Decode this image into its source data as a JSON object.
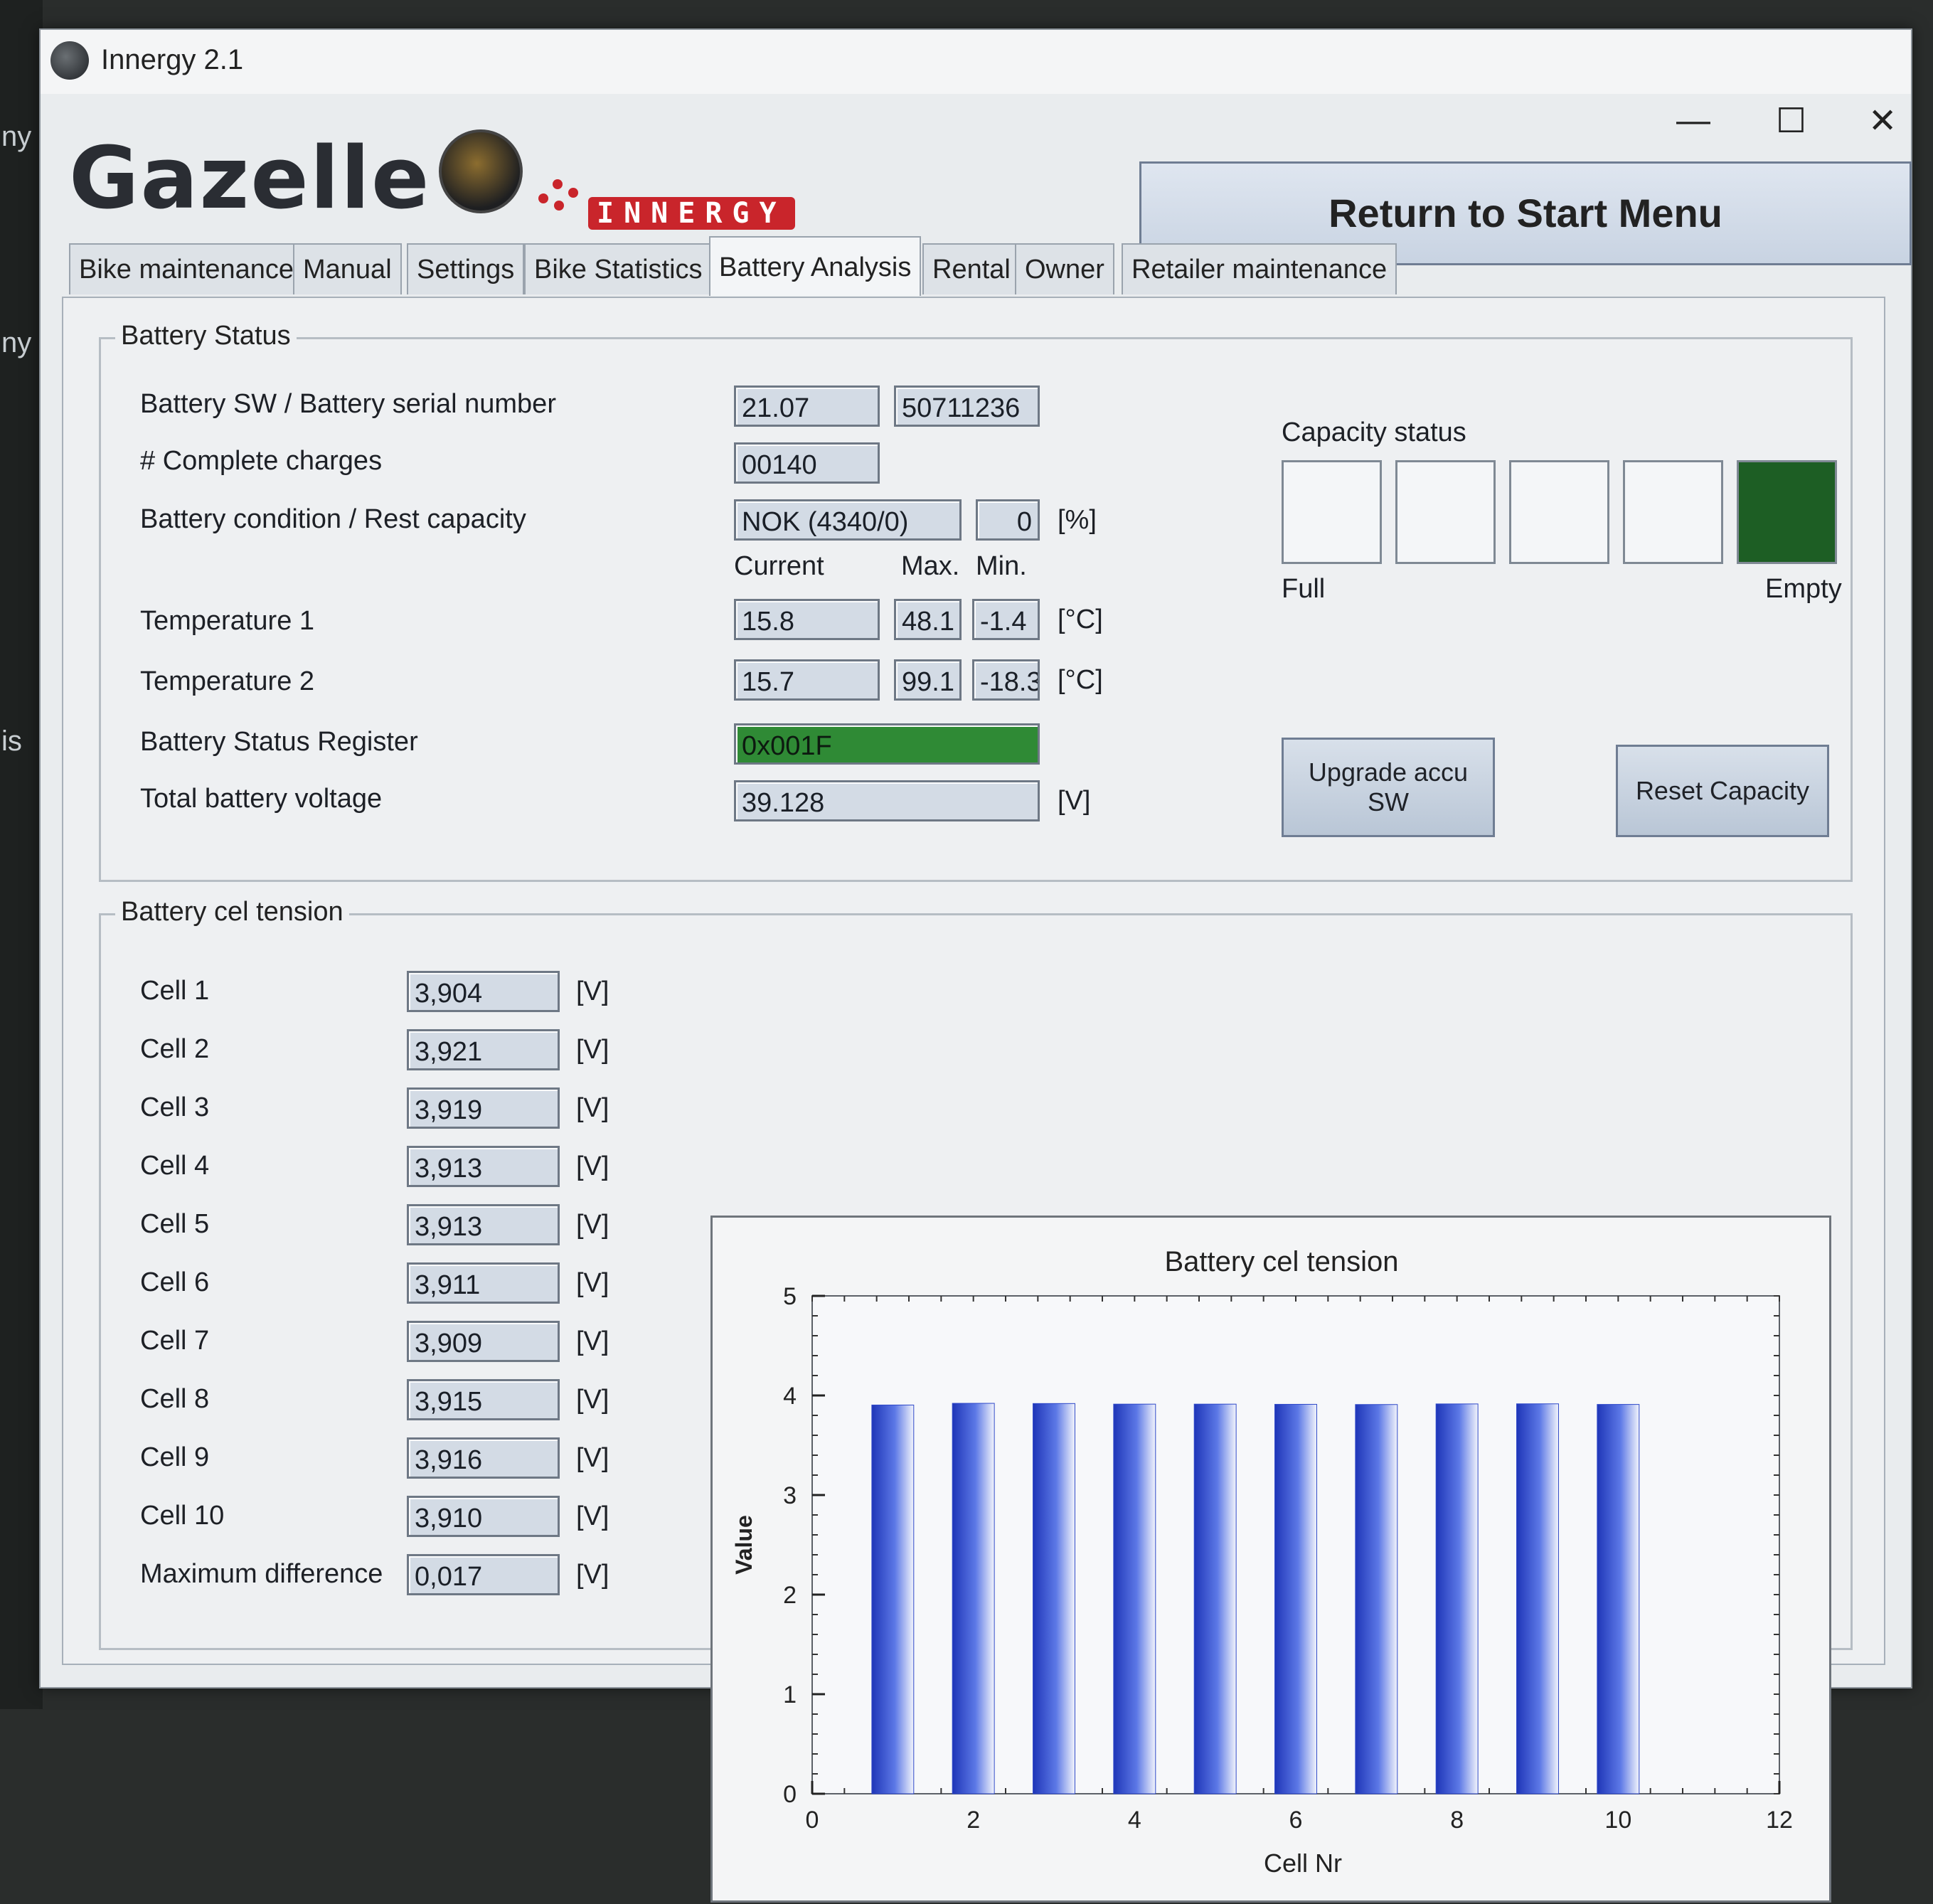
{
  "window": {
    "app_title": "Innergy 2.1",
    "brand": "Gazelle",
    "sub_brand": "INNERGY",
    "controls": {
      "minimize": "—",
      "maximize": "☐",
      "close": "✕"
    },
    "return_button": "Return to Start Menu"
  },
  "tabs": [
    "Bike maintenance",
    "Manual",
    "Settings",
    "Bike Statistics",
    "Battery Analysis",
    "Rental",
    "Owner",
    "Retailer maintenance"
  ],
  "active_tab": "Battery Analysis",
  "battery_status": {
    "legend": "Battery Status",
    "labels": {
      "sw_serial": "Battery SW / Battery serial number",
      "charges": "# Complete charges",
      "condition": "Battery condition / Rest capacity",
      "temp1": "Temperature 1",
      "temp2": "Temperature 2",
      "register": "Battery Status Register",
      "voltage": "Total battery voltage"
    },
    "column_headers": {
      "current": "Current",
      "max": "Max.",
      "min": "Min."
    },
    "values": {
      "sw": "21.07",
      "serial": "50711236",
      "charges": "00140",
      "condition": "NOK (4340/0)",
      "rest_capacity": "0",
      "temp1_current": "15.8",
      "temp1_max": "48.1",
      "temp1_min": "-1.4",
      "temp2_current": "15.7",
      "temp2_max": "99.1",
      "temp2_min": "-18.3",
      "register": "0x001F",
      "voltage": "39.128"
    },
    "units": {
      "percent": "[%]",
      "celsius": "[°C]",
      "volt": "[V]"
    },
    "register_color": "#2f8a35"
  },
  "capacity_status": {
    "label": "Capacity status",
    "full_label": "Full",
    "empty_label": "Empty",
    "filled_color": "#1d5e24"
  },
  "buttons": {
    "upgrade_line1": "Upgrade accu",
    "upgrade_line2": "SW",
    "reset": "Reset Capacity"
  },
  "cell_tension": {
    "legend": "Battery cel tension",
    "unit": "[V]",
    "cells": [
      {
        "label": "Cell 1",
        "value": "3,904"
      },
      {
        "label": "Cell 2",
        "value": "3,921"
      },
      {
        "label": "Cell 3",
        "value": "3,919"
      },
      {
        "label": "Cell 4",
        "value": "3,913"
      },
      {
        "label": "Cell 5",
        "value": "3,913"
      },
      {
        "label": "Cell 6",
        "value": "3,911"
      },
      {
        "label": "Cell 7",
        "value": "3,909"
      },
      {
        "label": "Cell 8",
        "value": "3,915"
      },
      {
        "label": "Cell 9",
        "value": "3,916"
      },
      {
        "label": "Cell 10",
        "value": "3,910"
      }
    ],
    "max_diff_label": "Maximum difference",
    "max_diff_value": "0,017"
  },
  "chart_data": {
    "type": "bar",
    "title": "Battery cel tension",
    "xlabel": "Cell Nr",
    "ylabel": "Value",
    "x": [
      1,
      2,
      3,
      4,
      5,
      6,
      7,
      8,
      9,
      10
    ],
    "values": [
      3.904,
      3.921,
      3.919,
      3.913,
      3.913,
      3.911,
      3.909,
      3.915,
      3.916,
      3.91
    ],
    "xlim": [
      0,
      12
    ],
    "ylim": [
      0,
      5
    ],
    "x_ticks": [
      0,
      2,
      4,
      6,
      8,
      10,
      12
    ],
    "y_ticks": [
      0,
      1,
      2,
      3,
      4,
      5
    ],
    "bar_color": "#2f49c9",
    "grid": false,
    "legend": "none"
  }
}
